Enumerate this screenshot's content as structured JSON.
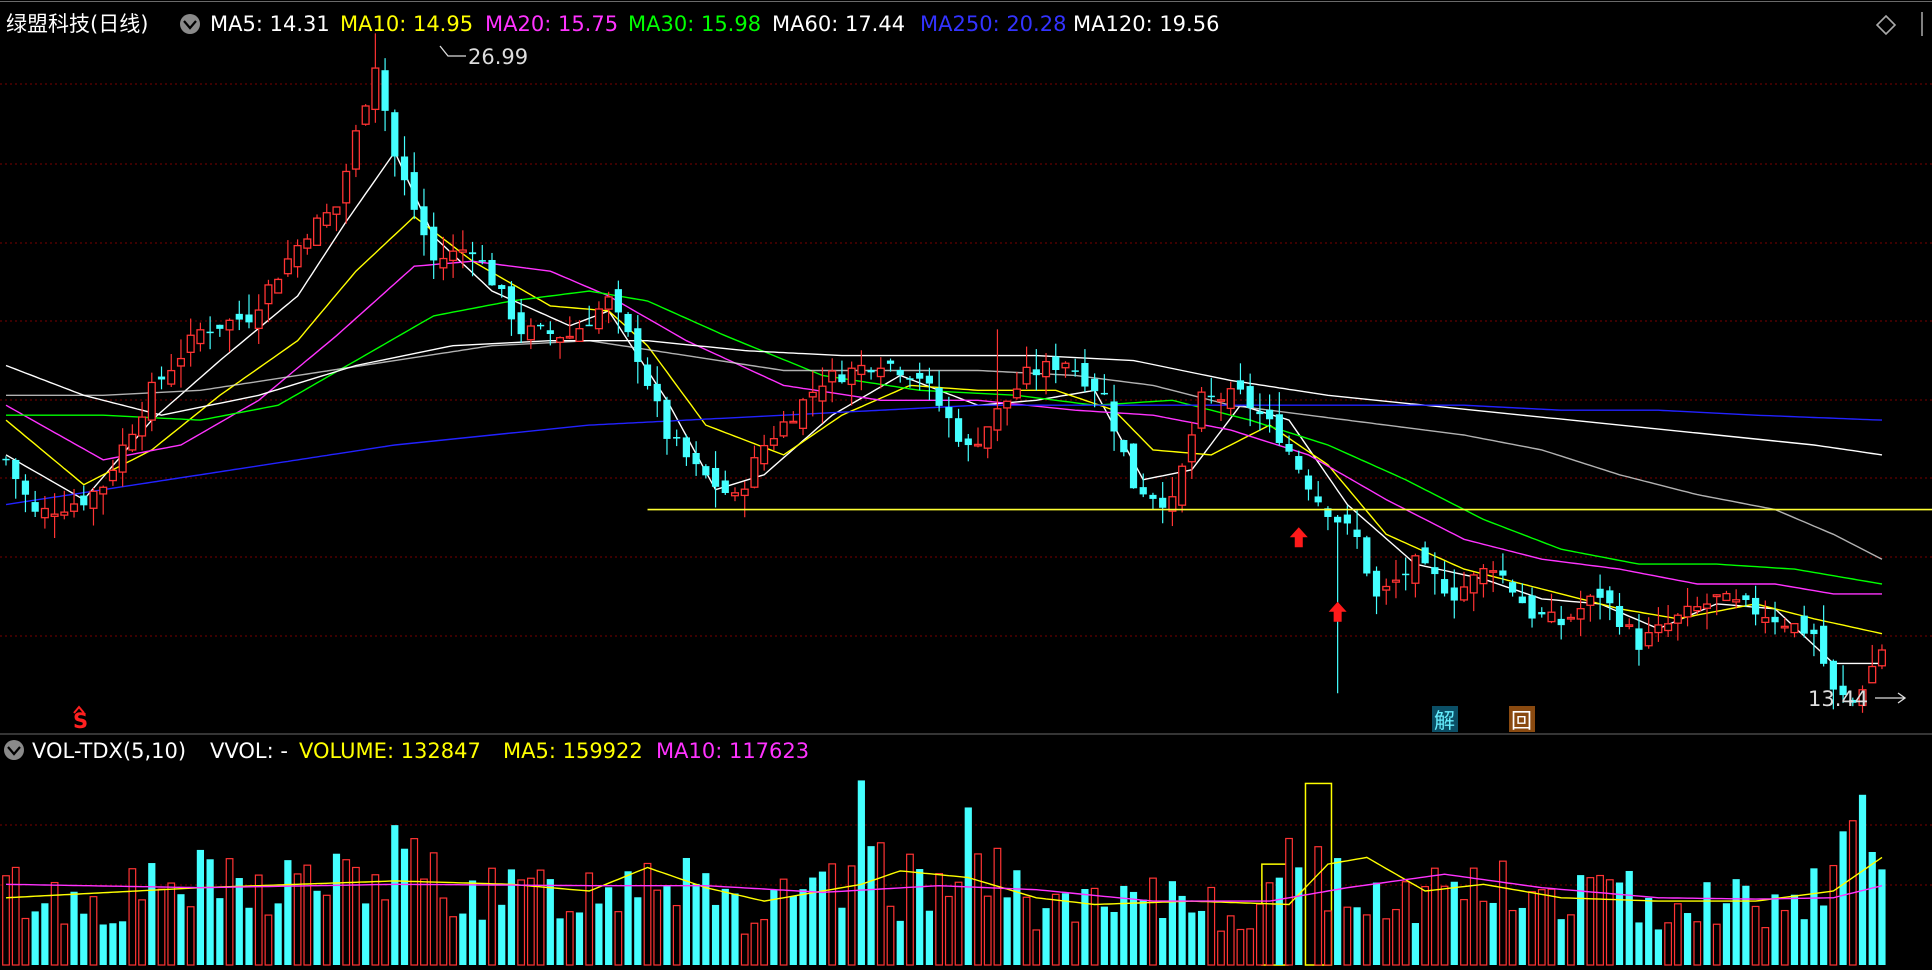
{
  "price_legend": {
    "title": "绿盟科技(日线)",
    "items": [
      {
        "label": "MA5: 14.31",
        "color": "#ffffff"
      },
      {
        "label": "MA10: 14.95",
        "color": "#ffff00"
      },
      {
        "label": "MA20: 15.75",
        "color": "#ff33ff"
      },
      {
        "label": "MA30: 15.98",
        "color": "#00ff00"
      },
      {
        "label": "MA60: 17.44",
        "color": "#ffffff"
      },
      {
        "label": "MA250: 20.28",
        "color": "#3333ff"
      },
      {
        "label": "MA120: 19.56",
        "color": "#ffffff"
      }
    ]
  },
  "vol_legend": {
    "title": "VOL-TDX(5,10)",
    "items": [
      {
        "label": "VVOL: -",
        "color": "#ffffff"
      },
      {
        "label": "VOLUME: 132847",
        "color": "#ffff00"
      },
      {
        "label": "MA5: 159922",
        "color": "#ffff00"
      },
      {
        "label": "MA10: 117623",
        "color": "#ff33ff"
      }
    ]
  },
  "annotations": {
    "high_label": "26.99",
    "low_label": "13.44",
    "badge_jie": "解",
    "badge_hui": "回",
    "marker_s": "S"
  },
  "colors": {
    "up": "#ff3333",
    "down": "#44ffff",
    "ma5": "#ffffff",
    "ma10": "#ffff00",
    "ma20": "#ff33ff",
    "ma30": "#00ff00",
    "ma60": "#dddddd",
    "ma120": "#ffffff",
    "ma250": "#2222ff",
    "grid": "#7a0000",
    "support": "#ffff33"
  },
  "chart_data": [
    {
      "type": "candlestick",
      "title": "绿盟科技(日线)",
      "y_range": [
        13.0,
        27.5
      ],
      "support_level": 17.4,
      "high_point": 26.99,
      "low_point": 13.44,
      "close_path": [
        [
          0,
          18.4
        ],
        [
          3,
          17.3
        ],
        [
          8,
          17.6
        ],
        [
          10,
          17.9
        ],
        [
          15,
          19.8
        ],
        [
          20,
          21.0
        ],
        [
          25,
          21.3
        ],
        [
          31,
          23.0
        ],
        [
          34,
          23.5
        ],
        [
          38,
          26.4
        ],
        [
          40,
          24.5
        ],
        [
          44,
          22.4
        ],
        [
          48,
          22.7
        ],
        [
          53,
          21.0
        ],
        [
          58,
          20.9
        ],
        [
          62,
          21.6
        ],
        [
          65,
          20.5
        ],
        [
          68,
          18.9
        ],
        [
          71,
          18.2
        ],
        [
          75,
          17.6
        ],
        [
          78,
          18.7
        ],
        [
          84,
          20.0
        ],
        [
          90,
          20.4
        ],
        [
          94,
          20.1
        ],
        [
          99,
          18.6
        ],
        [
          105,
          20.1
        ],
        [
          109,
          20.4
        ],
        [
          113,
          19.7
        ],
        [
          116,
          17.9
        ],
        [
          120,
          17.5
        ],
        [
          123,
          19.6
        ],
        [
          127,
          19.7
        ],
        [
          131,
          18.9
        ],
        [
          135,
          17.6
        ],
        [
          139,
          16.8
        ],
        [
          141,
          15.6
        ],
        [
          145,
          16.3
        ],
        [
          149,
          15.7
        ],
        [
          153,
          16.3
        ],
        [
          157,
          15.3
        ],
        [
          160,
          15.1
        ],
        [
          164,
          15.7
        ],
        [
          168,
          14.7
        ],
        [
          172,
          15.2
        ],
        [
          176,
          15.6
        ],
        [
          181,
          15.3
        ],
        [
          186,
          14.9
        ],
        [
          188,
          13.7
        ],
        [
          190,
          13.5
        ],
        [
          193,
          14.6
        ]
      ],
      "ma_paths": {
        "MA5": [
          [
            0,
            18.5
          ],
          [
            8,
            17.6
          ],
          [
            15,
            19.2
          ],
          [
            22,
            20.4
          ],
          [
            30,
            21.7
          ],
          [
            35,
            23.2
          ],
          [
            40,
            24.6
          ],
          [
            44,
            22.9
          ],
          [
            50,
            21.8
          ],
          [
            58,
            21.1
          ],
          [
            62,
            21.4
          ],
          [
            68,
            19.6
          ],
          [
            73,
            17.8
          ],
          [
            78,
            18.1
          ],
          [
            85,
            19.3
          ],
          [
            92,
            20.1
          ],
          [
            100,
            19.5
          ],
          [
            106,
            19.6
          ],
          [
            112,
            19.8
          ],
          [
            117,
            18.0
          ],
          [
            122,
            18.2
          ],
          [
            127,
            19.5
          ],
          [
            132,
            19.2
          ],
          [
            138,
            17.5
          ],
          [
            145,
            16.3
          ],
          [
            152,
            16.0
          ],
          [
            158,
            15.6
          ],
          [
            164,
            15.5
          ],
          [
            170,
            15.0
          ],
          [
            176,
            15.5
          ],
          [
            182,
            15.4
          ],
          [
            188,
            14.3
          ],
          [
            193,
            14.3
          ]
        ],
        "MA10": [
          [
            0,
            19.2
          ],
          [
            8,
            17.9
          ],
          [
            15,
            18.6
          ],
          [
            22,
            19.7
          ],
          [
            30,
            20.8
          ],
          [
            36,
            22.2
          ],
          [
            42,
            23.3
          ],
          [
            48,
            22.4
          ],
          [
            56,
            21.5
          ],
          [
            62,
            21.4
          ],
          [
            66,
            20.7
          ],
          [
            72,
            19.1
          ],
          [
            80,
            18.5
          ],
          [
            86,
            19.3
          ],
          [
            93,
            19.9
          ],
          [
            100,
            19.8
          ],
          [
            108,
            19.8
          ],
          [
            114,
            19.4
          ],
          [
            118,
            18.6
          ],
          [
            124,
            18.5
          ],
          [
            130,
            19.1
          ],
          [
            136,
            18.3
          ],
          [
            142,
            16.9
          ],
          [
            150,
            16.2
          ],
          [
            158,
            15.8
          ],
          [
            166,
            15.4
          ],
          [
            172,
            15.2
          ],
          [
            180,
            15.5
          ],
          [
            186,
            15.2
          ],
          [
            193,
            14.9
          ]
        ],
        "MA20": [
          [
            0,
            19.5
          ],
          [
            10,
            18.4
          ],
          [
            18,
            18.7
          ],
          [
            26,
            19.6
          ],
          [
            34,
            20.9
          ],
          [
            42,
            22.3
          ],
          [
            48,
            22.4
          ],
          [
            56,
            22.2
          ],
          [
            62,
            21.7
          ],
          [
            70,
            20.8
          ],
          [
            80,
            19.9
          ],
          [
            90,
            19.6
          ],
          [
            100,
            19.6
          ],
          [
            110,
            19.4
          ],
          [
            118,
            19.3
          ],
          [
            126,
            19.0
          ],
          [
            134,
            18.5
          ],
          [
            142,
            17.6
          ],
          [
            150,
            16.8
          ],
          [
            158,
            16.4
          ],
          [
            166,
            16.2
          ],
          [
            174,
            15.9
          ],
          [
            182,
            15.9
          ],
          [
            188,
            15.7
          ],
          [
            193,
            15.7
          ]
        ],
        "MA30": [
          [
            0,
            19.3
          ],
          [
            10,
            19.3
          ],
          [
            20,
            19.2
          ],
          [
            28,
            19.5
          ],
          [
            36,
            20.4
          ],
          [
            44,
            21.3
          ],
          [
            52,
            21.6
          ],
          [
            60,
            21.8
          ],
          [
            66,
            21.6
          ],
          [
            74,
            20.9
          ],
          [
            84,
            20.1
          ],
          [
            94,
            19.8
          ],
          [
            104,
            19.7
          ],
          [
            112,
            19.5
          ],
          [
            120,
            19.6
          ],
          [
            128,
            19.2
          ],
          [
            136,
            18.7
          ],
          [
            144,
            18.0
          ],
          [
            152,
            17.2
          ],
          [
            160,
            16.6
          ],
          [
            168,
            16.3
          ],
          [
            176,
            16.3
          ],
          [
            184,
            16.2
          ],
          [
            193,
            15.9
          ]
        ],
        "MA60": [
          [
            0,
            19.7
          ],
          [
            10,
            19.7
          ],
          [
            20,
            19.8
          ],
          [
            30,
            20.1
          ],
          [
            40,
            20.4
          ],
          [
            50,
            20.7
          ],
          [
            60,
            20.8
          ],
          [
            70,
            20.5
          ],
          [
            80,
            20.2
          ],
          [
            90,
            20.2
          ],
          [
            100,
            20.2
          ],
          [
            110,
            20.1
          ],
          [
            118,
            19.9
          ],
          [
            126,
            19.5
          ],
          [
            134,
            19.3
          ],
          [
            142,
            19.1
          ],
          [
            150,
            18.9
          ],
          [
            158,
            18.6
          ],
          [
            166,
            18.1
          ],
          [
            174,
            17.7
          ],
          [
            182,
            17.4
          ],
          [
            188,
            16.9
          ],
          [
            193,
            16.4
          ]
        ],
        "MA120": [
          [
            0,
            20.3
          ],
          [
            8,
            19.7
          ],
          [
            16,
            19.3
          ],
          [
            26,
            19.7
          ],
          [
            36,
            20.3
          ],
          [
            46,
            20.7
          ],
          [
            56,
            20.8
          ],
          [
            66,
            20.8
          ],
          [
            76,
            20.6
          ],
          [
            86,
            20.5
          ],
          [
            96,
            20.5
          ],
          [
            106,
            20.5
          ],
          [
            116,
            20.4
          ],
          [
            126,
            20.0
          ],
          [
            136,
            19.7
          ],
          [
            146,
            19.5
          ],
          [
            156,
            19.3
          ],
          [
            166,
            19.1
          ],
          [
            176,
            18.9
          ],
          [
            186,
            18.7
          ],
          [
            193,
            18.5
          ]
        ],
        "MA250": [
          [
            0,
            17.5
          ],
          [
            10,
            17.8
          ],
          [
            20,
            18.1
          ],
          [
            30,
            18.4
          ],
          [
            40,
            18.7
          ],
          [
            50,
            18.9
          ],
          [
            60,
            19.1
          ],
          [
            70,
            19.2
          ],
          [
            80,
            19.3
          ],
          [
            90,
            19.4
          ],
          [
            100,
            19.5
          ],
          [
            110,
            19.5
          ],
          [
            120,
            19.5
          ],
          [
            130,
            19.5
          ],
          [
            140,
            19.5
          ],
          [
            150,
            19.5
          ],
          [
            160,
            19.4
          ],
          [
            170,
            19.4
          ],
          [
            180,
            19.3
          ],
          [
            193,
            19.2
          ]
        ]
      },
      "arrows_up_at": [
        [
          133,
          16.8
        ],
        [
          137,
          15.3
        ]
      ]
    },
    {
      "type": "bar",
      "title": "VOL-TDX(5,10)",
      "volume": 132847,
      "ma5": 159922,
      "ma10": 117623,
      "volume_range": [
        0,
        290000
      ],
      "volume_path": [
        [
          0,
          110000
        ],
        [
          8,
          90000
        ],
        [
          15,
          110000
        ],
        [
          20,
          120000
        ],
        [
          26,
          110000
        ],
        [
          30,
          130000
        ],
        [
          36,
          120000
        ],
        [
          40,
          150000
        ],
        [
          44,
          130000
        ],
        [
          50,
          100000
        ],
        [
          56,
          110000
        ],
        [
          62,
          110000
        ],
        [
          66,
          160000
        ],
        [
          69,
          140000
        ],
        [
          72,
          150000
        ],
        [
          76,
          70000
        ],
        [
          80,
          90000
        ],
        [
          86,
          110000
        ],
        [
          88,
          190000
        ],
        [
          92,
          110000
        ],
        [
          96,
          130000
        ],
        [
          98,
          210000
        ],
        [
          102,
          120000
        ],
        [
          106,
          90000
        ],
        [
          112,
          80000
        ],
        [
          118,
          90000
        ],
        [
          122,
          110000
        ],
        [
          126,
          80000
        ],
        [
          130,
          90000
        ],
        [
          133,
          150000
        ],
        [
          134,
          270000
        ],
        [
          135,
          270000
        ],
        [
          136,
          120000
        ],
        [
          140,
          110000
        ],
        [
          145,
          100000
        ],
        [
          150,
          130000
        ],
        [
          154,
          110000
        ],
        [
          158,
          90000
        ],
        [
          162,
          110000
        ],
        [
          166,
          100000
        ],
        [
          170,
          95000
        ],
        [
          175,
          100000
        ],
        [
          180,
          95000
        ],
        [
          184,
          90000
        ],
        [
          188,
          160000
        ],
        [
          190,
          200000
        ],
        [
          193,
          140000
        ]
      ],
      "vma5_path": [
        [
          0,
          100000
        ],
        [
          20,
          115000
        ],
        [
          40,
          125000
        ],
        [
          52,
          120000
        ],
        [
          60,
          110000
        ],
        [
          66,
          145000
        ],
        [
          72,
          115000
        ],
        [
          78,
          95000
        ],
        [
          88,
          120000
        ],
        [
          92,
          140000
        ],
        [
          99,
          130000
        ],
        [
          106,
          100000
        ],
        [
          112,
          90000
        ],
        [
          122,
          95000
        ],
        [
          132,
          90000
        ],
        [
          136,
          150000
        ],
        [
          140,
          160000
        ],
        [
          146,
          110000
        ],
        [
          152,
          120000
        ],
        [
          160,
          100000
        ],
        [
          170,
          95000
        ],
        [
          180,
          95000
        ],
        [
          188,
          110000
        ],
        [
          193,
          160000
        ]
      ],
      "vma10_path": [
        [
          0,
          120000
        ],
        [
          20,
          115000
        ],
        [
          40,
          120000
        ],
        [
          60,
          118000
        ],
        [
          72,
          118000
        ],
        [
          84,
          108000
        ],
        [
          96,
          118000
        ],
        [
          106,
          112000
        ],
        [
          118,
          95000
        ],
        [
          130,
          95000
        ],
        [
          138,
          115000
        ],
        [
          148,
          135000
        ],
        [
          158,
          115000
        ],
        [
          170,
          100000
        ],
        [
          180,
          98000
        ],
        [
          188,
          100000
        ],
        [
          193,
          118000
        ]
      ]
    }
  ]
}
